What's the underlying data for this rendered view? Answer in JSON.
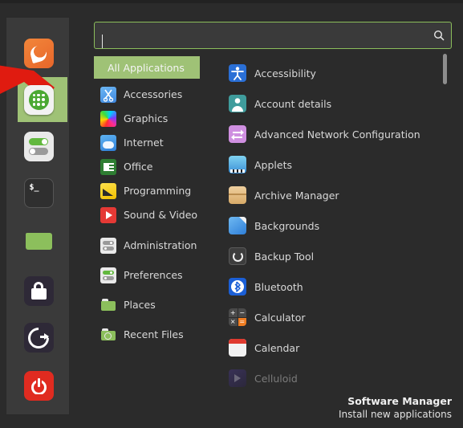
{
  "window": {
    "background_color": "#2b2b2b",
    "accent_green": "#9fc276",
    "border_green": "#8bbd5b"
  },
  "launcher": {
    "items": [
      {
        "name": "firefox",
        "label": "Firefox Web Browser",
        "icon": "firefox-icon",
        "selected": false
      },
      {
        "name": "menu",
        "label": "Menu",
        "icon": "applications-grid-icon",
        "selected": true
      },
      {
        "name": "settings",
        "label": "System Settings",
        "icon": "toggle-switches-icon",
        "selected": false
      },
      {
        "name": "terminal",
        "label": "Terminal",
        "icon": "terminal-icon",
        "selected": false
      },
      {
        "name": "files",
        "label": "Files",
        "icon": "folder-icon",
        "selected": false
      },
      {
        "name": "lock",
        "label": "Lock Screen",
        "icon": "padlock-icon",
        "selected": false
      },
      {
        "name": "logout",
        "label": "Log Out",
        "icon": "logout-icon",
        "selected": false
      },
      {
        "name": "shutdown",
        "label": "Shut Down",
        "icon": "power-icon",
        "selected": false
      }
    ]
  },
  "pointer": {
    "type": "arrow-annotation",
    "color": "#e01b10",
    "points_to": "menu-launcher-icon"
  },
  "search": {
    "value": "",
    "placeholder": "",
    "icon": "search-icon",
    "focused": true
  },
  "categories": {
    "selected": "All Applications",
    "items": [
      {
        "label": "All Applications",
        "icon": "all-applications-icon",
        "selected": true
      },
      {
        "label": "Accessories",
        "icon": "accessories-scissors-icon",
        "selected": false
      },
      {
        "label": "Graphics",
        "icon": "graphics-color-wheel-icon",
        "selected": false
      },
      {
        "label": "Internet",
        "icon": "internet-cloud-icon",
        "selected": false
      },
      {
        "label": "Office",
        "icon": "office-document-icon",
        "selected": false
      },
      {
        "label": "Programming",
        "icon": "programming-icon",
        "selected": false
      },
      {
        "label": "Sound & Video",
        "icon": "sound-video-play-icon",
        "selected": false
      },
      {
        "label": "Administration",
        "icon": "administration-toggles-icon",
        "selected": false
      },
      {
        "label": "Preferences",
        "icon": "preferences-toggles-icon",
        "selected": false
      },
      {
        "label": "Places",
        "icon": "places-folder-icon",
        "selected": false
      },
      {
        "label": "Recent Files",
        "icon": "recent-files-clock-folder-icon",
        "selected": false
      }
    ]
  },
  "applications": {
    "items": [
      {
        "label": "Accessibility",
        "icon": "accessibility-icon",
        "dimmed": false
      },
      {
        "label": "Account details",
        "icon": "account-details-icon",
        "dimmed": false
      },
      {
        "label": "Advanced Network Configuration",
        "icon": "advanced-network-configuration-icon",
        "dimmed": false
      },
      {
        "label": "Applets",
        "icon": "applets-icon",
        "dimmed": false
      },
      {
        "label": "Archive Manager",
        "icon": "archive-manager-icon",
        "dimmed": false
      },
      {
        "label": "Backgrounds",
        "icon": "backgrounds-icon",
        "dimmed": false
      },
      {
        "label": "Backup Tool",
        "icon": "backup-tool-icon",
        "dimmed": false
      },
      {
        "label": "Bluetooth",
        "icon": "bluetooth-icon",
        "dimmed": false
      },
      {
        "label": "Calculator",
        "icon": "calculator-icon",
        "dimmed": false
      },
      {
        "label": "Calendar",
        "icon": "calendar-icon",
        "dimmed": false
      },
      {
        "label": "Celluloid",
        "icon": "celluloid-icon",
        "dimmed": true
      }
    ]
  },
  "scrollbar": {
    "orientation": "vertical",
    "thumb_position_percent": 0,
    "thumb_size_percent": 9
  },
  "footer": {
    "title": "Software Manager",
    "subtitle": "Install new applications"
  }
}
